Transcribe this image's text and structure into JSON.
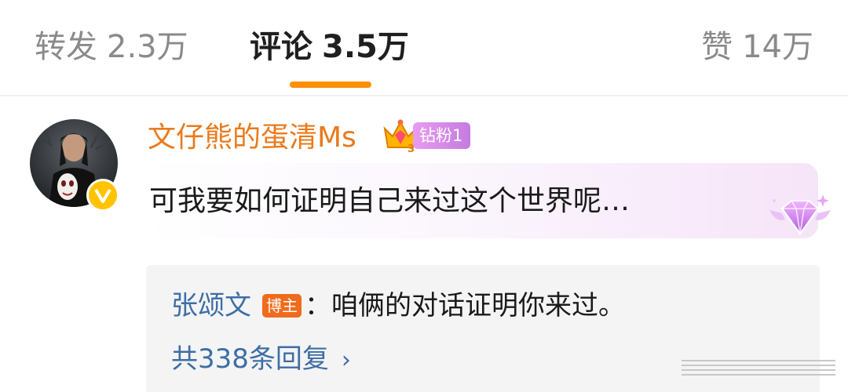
{
  "tabs": {
    "repost": {
      "label": "转发",
      "count": "2.3万"
    },
    "comments": {
      "label": "评论",
      "count": "3.5万"
    },
    "likes": {
      "label": "赞",
      "count": "14万"
    }
  },
  "colors": {
    "active_tab_indicator": "#ff8f00",
    "username": "#ea7a1a",
    "link_blue": "#3d6ea5",
    "author_tag": "#f06b1c",
    "fan_badge": "#d98be8",
    "vip_badge": "#ffc300"
  },
  "comment": {
    "username": "文仔熊的蛋清Ms",
    "fan_badge": "钻粉1",
    "crown_level": "3",
    "text": "可我要如何证明自己来过这个世界呢…",
    "icons": [
      "avatar",
      "verified-v-icon",
      "crown-icon",
      "diamond-gem-icon"
    ]
  },
  "reply": {
    "author": "张颂文",
    "author_tag": "博主",
    "text": "：咱俩的对话证明你来过。",
    "more_replies": "共338条回复",
    "chevron": "›"
  }
}
